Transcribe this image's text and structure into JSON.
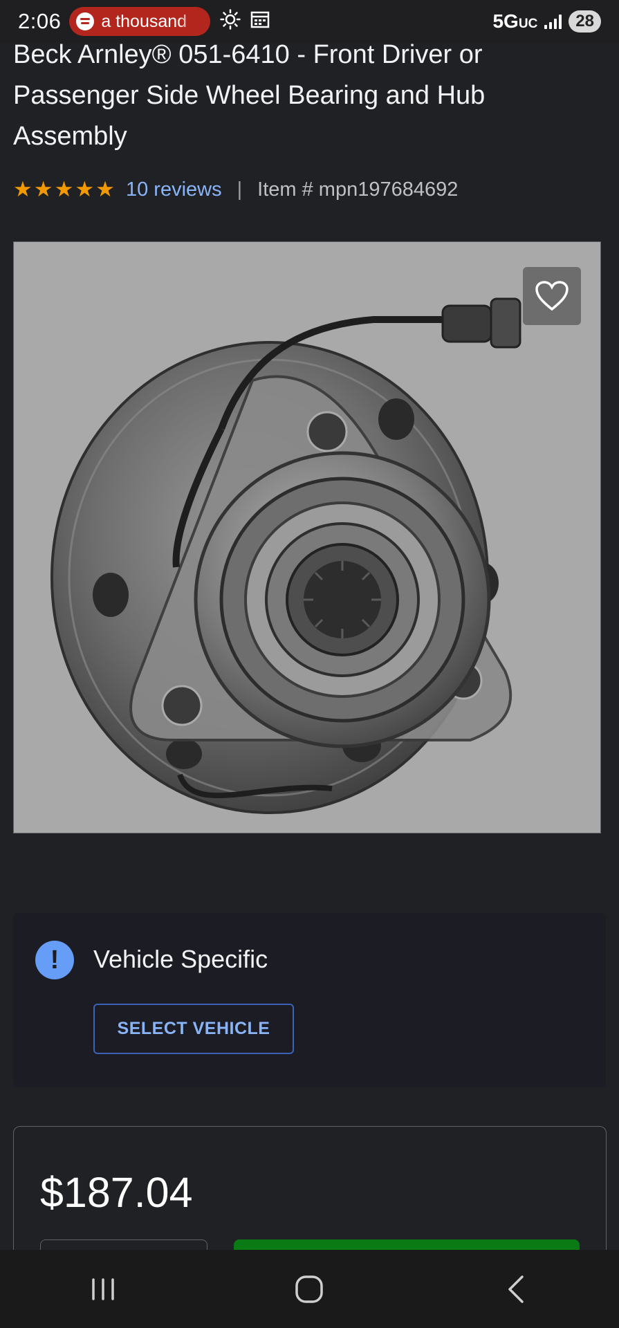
{
  "status_bar": {
    "time": "2:06",
    "now_playing": "a thousand",
    "network": "5G",
    "network_suffix": "UC",
    "battery": "28"
  },
  "product": {
    "title": "Beck Arnley® 051-6410 - Front Driver or Passenger Side Wheel Bearing and Hub Assembly",
    "rating_stars": "★★★★★",
    "rating": 5,
    "reviews_label": "10 reviews",
    "separator": "|",
    "item_number": "Item # mpn197684692"
  },
  "vehicle_notice": {
    "icon_glyph": "!",
    "title": "Vehicle Specific",
    "button_label": "SELECT VEHICLE"
  },
  "pricing": {
    "price": "$187.04"
  },
  "colors": {
    "background": "#202124",
    "link": "#8ab4f8",
    "star": "#f29900",
    "info": "#669df6",
    "add_to_cart": "#0a7a14"
  },
  "icons": {
    "favorite": "heart-outline-icon",
    "info": "exclamation-circle-icon",
    "nav_recents": "recents-icon",
    "nav_home": "home-icon",
    "nav_back": "back-icon"
  }
}
